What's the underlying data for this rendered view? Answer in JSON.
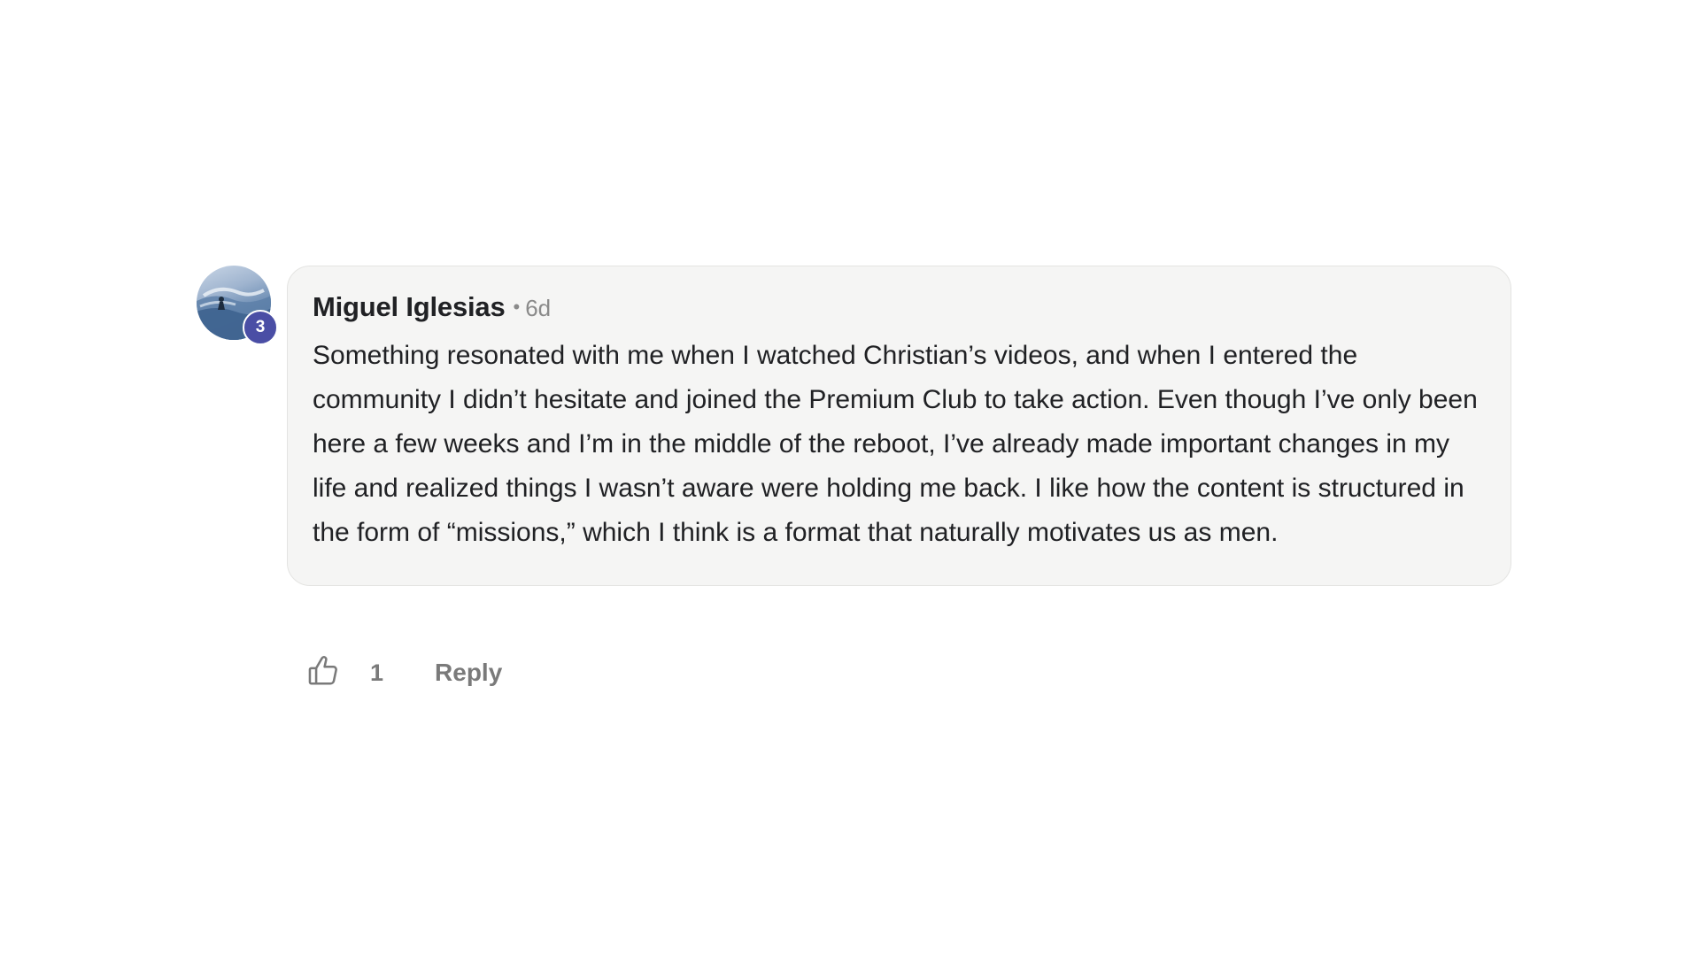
{
  "comment": {
    "author": "Miguel Iglesias",
    "separator": "•",
    "time": "6d",
    "level": "3",
    "text": "Something resonated with me when I watched Christian’s videos, and when I entered the community I didn’t hesitate and joined the Premium Club to take action. Even though I’ve only been here a few weeks and I’m in the middle of the reboot, I’ve already made important changes in my life and realized things I wasn’t aware were holding me back. I like how the content is structured in the form of “missions,” which I think is a format that naturally motivates us as men.",
    "likes": "1",
    "reply_label": "Reply"
  },
  "icons": {
    "like": "thumbs-up-icon",
    "avatar": "surfer-photo"
  },
  "colors": {
    "badge": "#4a4ea5",
    "bubble_bg": "#f5f5f4",
    "muted_text": "#7a7a7a"
  }
}
